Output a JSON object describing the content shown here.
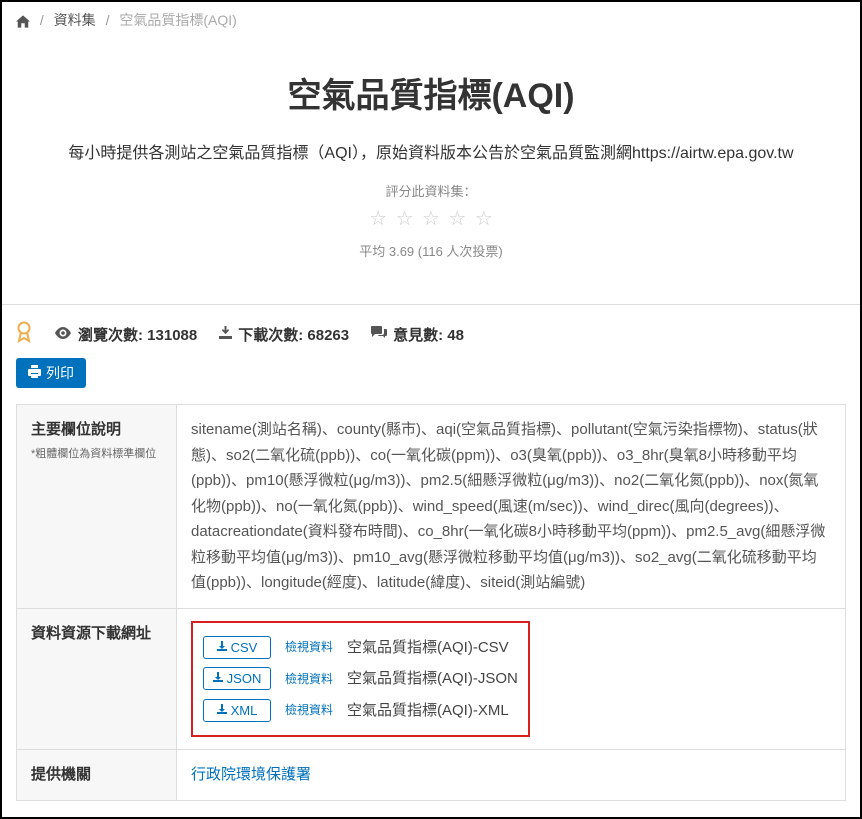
{
  "breadcrumb": {
    "home_icon": "⌂",
    "datasets": "資料集",
    "current": "空氣品質指標(AQI)"
  },
  "header": {
    "title": "空氣品質指標(AQI)",
    "subtitle": "每小時提供各測站之空氣品質指標（AQI），原始資料版本公告於空氣品質監測網https://airtw.epa.gov.tw",
    "rating_label": "評分此資料集：",
    "rating_text": "平均 3.69 (116 人次投票)"
  },
  "stats": {
    "views_label": "瀏覽次數: 131088",
    "downloads_label": "下載次數: 68263",
    "comments_label": "意見數: 48"
  },
  "print_btn": "列印",
  "fields": {
    "main_columns": {
      "label": "主要欄位說明",
      "sub_note": "*粗體欄位為資料標準欄位",
      "value": "sitename(測站名稱)、county(縣市)、aqi(空氣品質指標)、pollutant(空氣污染指標物)、status(狀態)、so2(二氧化硫(ppb))、co(一氧化碳(ppm))、o3(臭氧(ppb))、o3_8hr(臭氧8小時移動平均(ppb))、pm10(懸浮微粒(μg/m3))、pm2.5(細懸浮微粒(μg/m3))、no2(二氧化氮(ppb))、nox(氮氧化物(ppb))、no(一氧化氮(ppb))、wind_speed(風速(m/sec))、wind_direc(風向(degrees))、datacreationdate(資料發布時間)、co_8hr(一氧化碳8小時移動平均(ppm))、pm2.5_avg(細懸浮微粒移動平均值(μg/m3))、pm10_avg(懸浮微粒移動平均值(μg/m3))、so2_avg(二氧化硫移動平均值(ppb))、longitude(經度)、latitude(緯度)、siteid(測站編號)"
    },
    "download": {
      "label": "資料資源下載網址",
      "resources": [
        {
          "format": "CSV",
          "view": "檢視資料",
          "name": "空氣品質指標(AQI)-CSV"
        },
        {
          "format": "JSON",
          "view": "檢視資料",
          "name": "空氣品質指標(AQI)-JSON"
        },
        {
          "format": "XML",
          "view": "檢視資料",
          "name": "空氣品質指標(AQI)-XML"
        }
      ]
    },
    "provider": {
      "label": "提供機關",
      "value": "行政院環境保護署"
    }
  }
}
